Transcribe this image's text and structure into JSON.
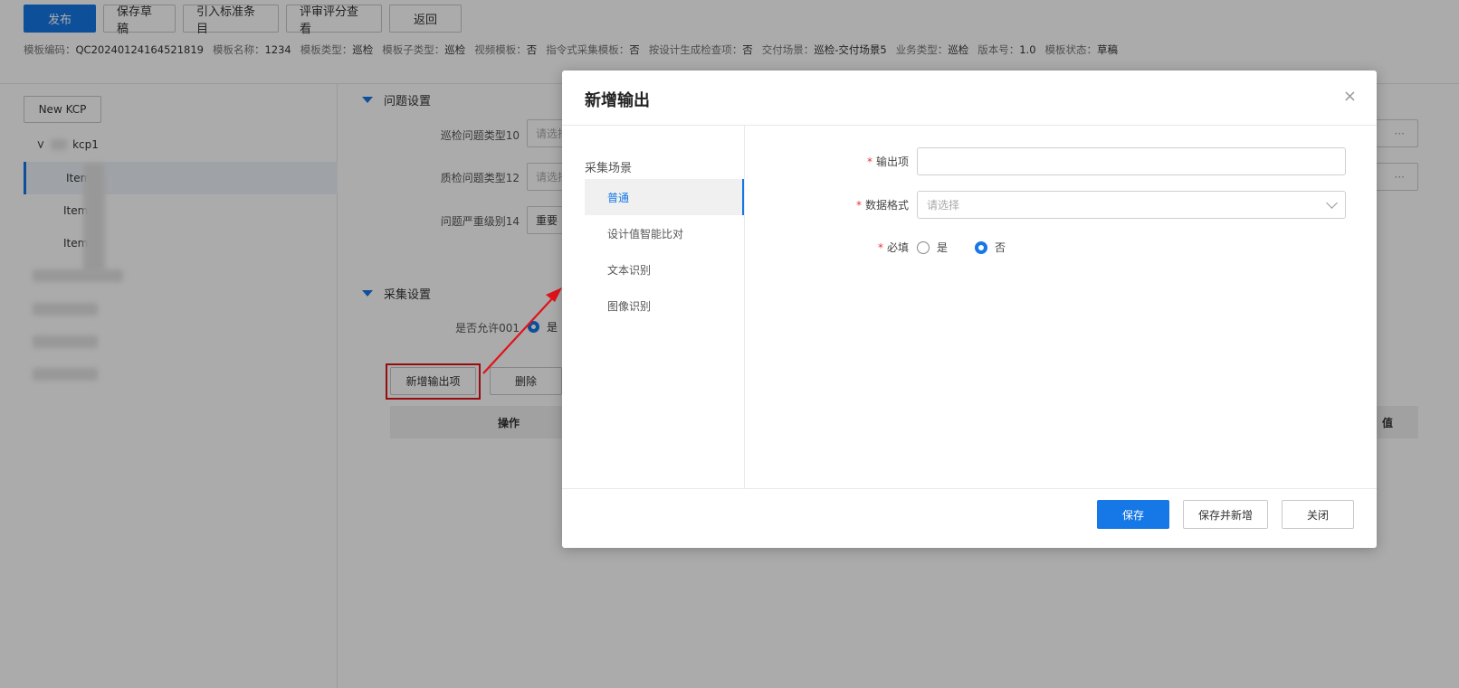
{
  "toolbar": {
    "publish": "发布",
    "save_draft": "保存草稿",
    "import_std": "引入标准条目",
    "review_score": "评审评分查看",
    "back": "返回"
  },
  "meta": [
    {
      "k": "模板编码：",
      "v": "QC20240124164521819"
    },
    {
      "k": "模板名称：",
      "v": "1234"
    },
    {
      "k": "模板类型：",
      "v": "巡检"
    },
    {
      "k": "模板子类型：",
      "v": "巡检"
    },
    {
      "k": "视频模板：",
      "v": "否"
    },
    {
      "k": "指令式采集模板：",
      "v": "否"
    },
    {
      "k": "按设计生成检查项：",
      "v": "否"
    },
    {
      "k": "交付场景：",
      "v": "巡检-交付场景5"
    },
    {
      "k": "业务类型：",
      "v": "巡检"
    },
    {
      "k": "版本号：",
      "v": "1.0"
    },
    {
      "k": "模板状态：",
      "v": "草稿"
    }
  ],
  "left": {
    "new_kcp": "New KCP",
    "root": "kcp1",
    "items": [
      "Item",
      "Item",
      "Item"
    ]
  },
  "bg": {
    "section_issue": "问题设置",
    "issue_type_label": "巡检问题类型10",
    "issue_type_placeholder": "请选择",
    "qc_type_label": "质检问题类型12",
    "qc_type_placeholder": "请选择",
    "severity_label": "问题严重级别14",
    "severity_value": "重要",
    "section_collect": "采集设置",
    "allow_label": "是否允许001",
    "allow_value": "是",
    "add_output": "新增输出项",
    "delete": "删除",
    "col_op": "操作",
    "col_value": "值",
    "ellipsis": "···"
  },
  "modal": {
    "title": "新增输出",
    "close": "×",
    "side_group": "采集场景",
    "side_items": [
      "普通",
      "设计值智能比对",
      "文本识别",
      "图像识别"
    ],
    "output_label": "输出项",
    "format_label": "数据格式",
    "format_placeholder": "请选择",
    "required_label": "必填",
    "yes": "是",
    "no": "否",
    "save": "保存",
    "save_new": "保存并新增",
    "close_btn": "关闭"
  },
  "colors": {
    "primary": "#1677e6",
    "required": "#e5383b",
    "annotation": "#e0131a"
  }
}
